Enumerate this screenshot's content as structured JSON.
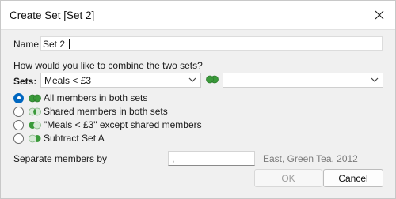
{
  "dialog": {
    "title": "Create Set [Set 2]"
  },
  "name": {
    "label": "Name:",
    "value": "Set 2"
  },
  "combine": {
    "question": "How would you like to combine the two sets?",
    "sets_label": "Sets:",
    "set_a": "Meals < £3",
    "set_b": ""
  },
  "options": [
    {
      "label": "All members in both sets",
      "icon": "venn-union-icon",
      "selected": true
    },
    {
      "label": "Shared members in both sets",
      "icon": "venn-intersection-icon",
      "selected": false
    },
    {
      "label": "\"Meals < £3\" except shared members",
      "icon": "venn-left-except-icon",
      "selected": false
    },
    {
      "label": "Subtract Set A",
      "icon": "venn-right-except-icon",
      "selected": false
    }
  ],
  "separator": {
    "label": "Separate members by",
    "value": ",",
    "example": "East, Green Tea, 2012"
  },
  "buttons": {
    "ok": "OK",
    "cancel": "Cancel"
  },
  "colors": {
    "accent": "#0067c0",
    "venn_green": "#3a9a3a",
    "venn_light": "#cfe6cf"
  }
}
